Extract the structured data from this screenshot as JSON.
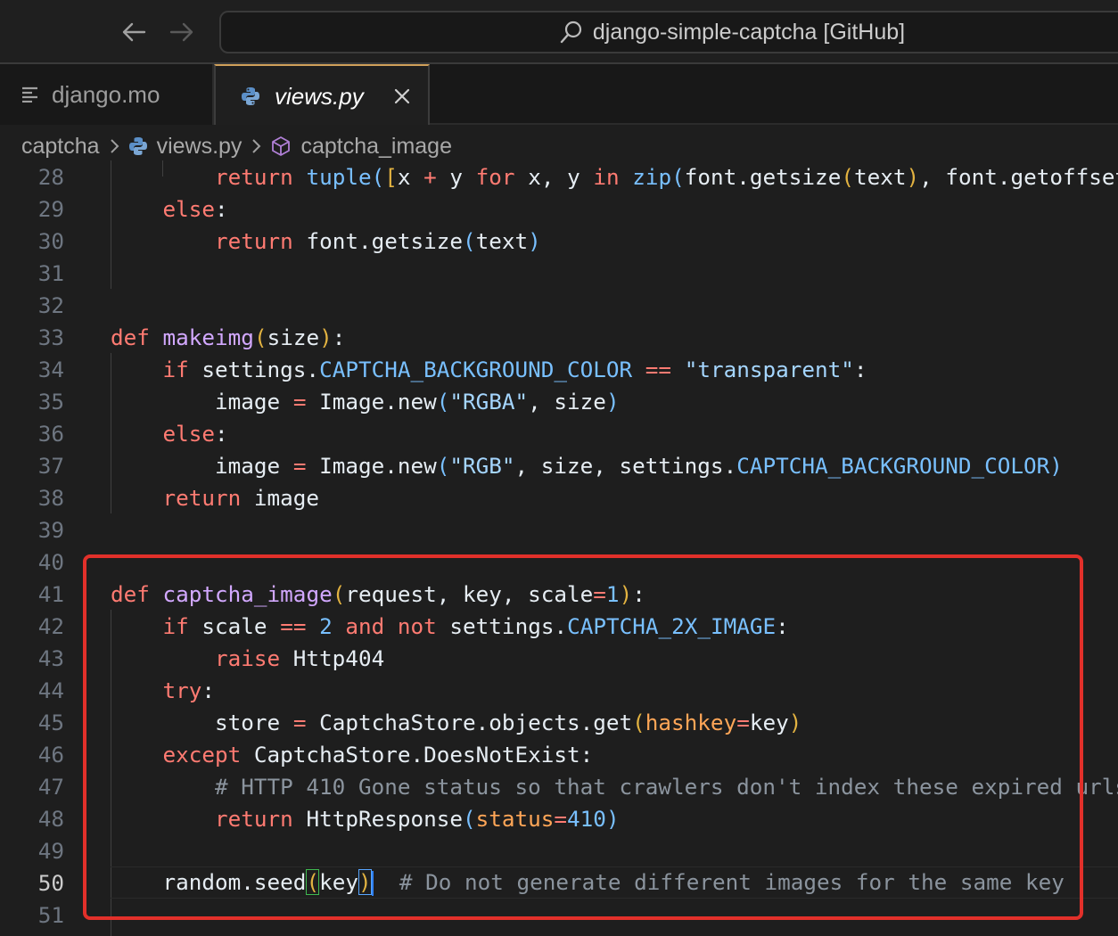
{
  "titlebar": {
    "search_text": "django-simple-captcha [GitHub]"
  },
  "tabs": [
    {
      "label": "django.mo",
      "active": false,
      "icon": "lines-icon"
    },
    {
      "label": "views.py",
      "active": true,
      "icon": "python-icon"
    }
  ],
  "breadcrumb": {
    "items": [
      "captcha",
      "views.py",
      "captcha_image"
    ]
  },
  "editor": {
    "current_line": 50,
    "lines": [
      {
        "no": "28",
        "text": "        return tuple([x + y for x, y in zip(font.getsize(text), font.getoffset"
      },
      {
        "no": "29",
        "text": "    else:"
      },
      {
        "no": "30",
        "text": "        return font.getsize(text)"
      },
      {
        "no": "31",
        "text": ""
      },
      {
        "no": "32",
        "text": ""
      },
      {
        "no": "33",
        "text": "def makeimg(size):"
      },
      {
        "no": "34",
        "text": "    if settings.CAPTCHA_BACKGROUND_COLOR == \"transparent\":"
      },
      {
        "no": "35",
        "text": "        image = Image.new(\"RGBA\", size)"
      },
      {
        "no": "36",
        "text": "    else:"
      },
      {
        "no": "37",
        "text": "        image = Image.new(\"RGB\", size, settings.CAPTCHA_BACKGROUND_COLOR)"
      },
      {
        "no": "38",
        "text": "    return image"
      },
      {
        "no": "39",
        "text": ""
      },
      {
        "no": "40",
        "text": ""
      },
      {
        "no": "41",
        "text": "def captcha_image(request, key, scale=1):"
      },
      {
        "no": "42",
        "text": "    if scale == 2 and not settings.CAPTCHA_2X_IMAGE:"
      },
      {
        "no": "43",
        "text": "        raise Http404"
      },
      {
        "no": "44",
        "text": "    try:"
      },
      {
        "no": "45",
        "text": "        store = CaptchaStore.objects.get(hashkey=key)"
      },
      {
        "no": "46",
        "text": "    except CaptchaStore.DoesNotExist:"
      },
      {
        "no": "47",
        "text": "        # HTTP 410 Gone status so that crawlers don't index these expired urls"
      },
      {
        "no": "48",
        "text": "        return HttpResponse(status=410)"
      },
      {
        "no": "49",
        "text": ""
      },
      {
        "no": "50",
        "text": "    random.seed(key)  # Do not generate different images for the same key"
      },
      {
        "no": "51",
        "text": ""
      }
    ]
  },
  "colors": {
    "keyword": "#ff7b72",
    "function": "#d2a8ff",
    "constant": "#79c0ff",
    "string": "#a5d6ff",
    "param": "#ffa657",
    "comment": "#8b949e",
    "highlight_box": "#e2302a",
    "active_tab_border": "#d0a05a"
  }
}
